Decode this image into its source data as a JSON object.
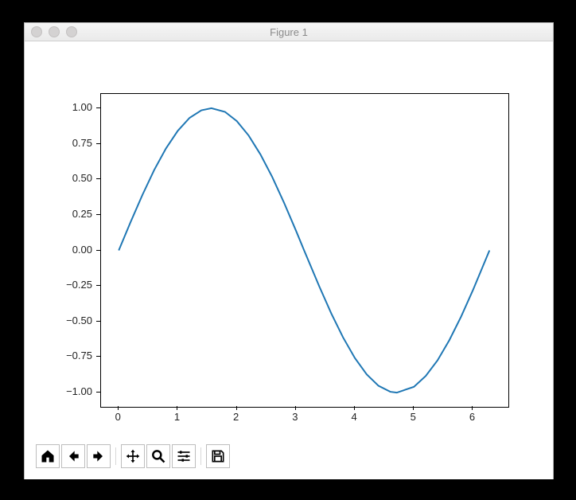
{
  "window": {
    "title": "Figure 1"
  },
  "chart_data": {
    "type": "line",
    "title": "",
    "xlabel": "",
    "ylabel": "",
    "xlim": [
      -0.3,
      6.6
    ],
    "ylim": [
      -1.1,
      1.1
    ],
    "xticks": [
      0,
      1,
      2,
      3,
      4,
      5,
      6
    ],
    "yticks": [
      -1.0,
      -0.75,
      -0.5,
      -0.25,
      0.0,
      0.25,
      0.5,
      0.75,
      1.0
    ],
    "x": [
      0.0,
      0.2,
      0.4,
      0.6,
      0.8,
      1.0,
      1.2,
      1.4,
      1.57,
      1.8,
      2.0,
      2.2,
      2.4,
      2.6,
      2.8,
      3.0,
      3.14,
      3.4,
      3.6,
      3.8,
      4.0,
      4.2,
      4.4,
      4.6,
      4.71,
      5.0,
      5.2,
      5.4,
      5.6,
      5.8,
      6.0,
      6.28
    ],
    "values": [
      0.0,
      0.199,
      0.389,
      0.565,
      0.717,
      0.841,
      0.932,
      0.985,
      1.0,
      0.974,
      0.909,
      0.808,
      0.675,
      0.516,
      0.335,
      0.141,
      0.0,
      -0.256,
      -0.443,
      -0.612,
      -0.757,
      -0.872,
      -0.952,
      -0.994,
      -1.0,
      -0.959,
      -0.883,
      -0.773,
      -0.631,
      -0.465,
      -0.279,
      0.0
    ],
    "color": "#1f77b4"
  },
  "xtick_labels": [
    "0",
    "1",
    "2",
    "3",
    "4",
    "5",
    "6"
  ],
  "ytick_labels": [
    "−1.00",
    "−0.75",
    "−0.50",
    "−0.25",
    "0.00",
    "0.25",
    "0.50",
    "0.75",
    "1.00"
  ],
  "toolbar": {
    "home": "Home",
    "back": "Back",
    "forward": "Forward",
    "pan": "Pan",
    "zoom": "Zoom",
    "configure": "Configure Subplots",
    "save": "Save"
  }
}
